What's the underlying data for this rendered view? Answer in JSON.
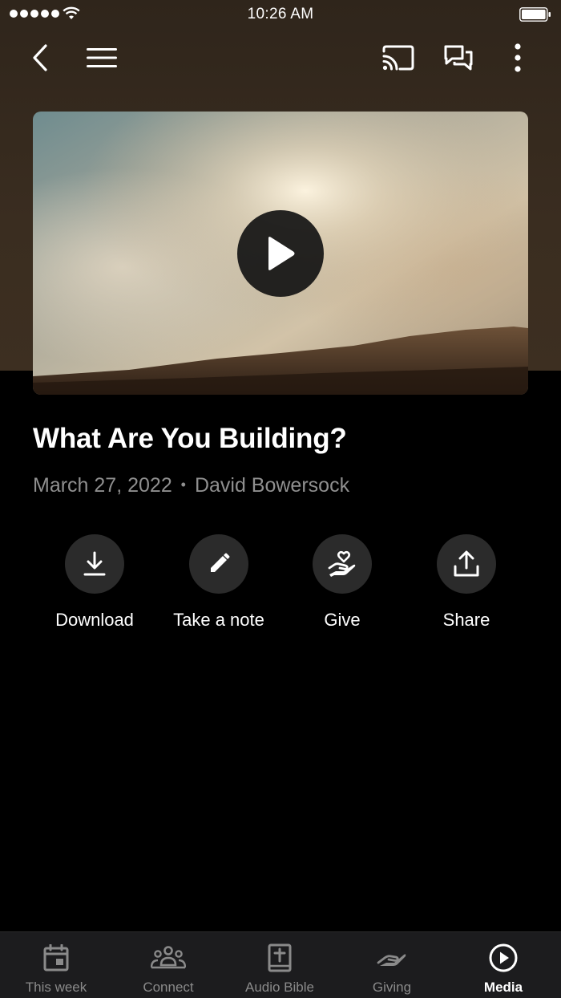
{
  "status_bar": {
    "time": "10:26 AM"
  },
  "toolbar": {
    "icons": [
      "back-icon",
      "menu-icon",
      "cast-icon",
      "chat-icon",
      "more-icon"
    ]
  },
  "video": {
    "play_icon": "play-icon"
  },
  "sermon": {
    "title": "What Are You Building?",
    "date": "March 27, 2022",
    "separator": "•",
    "speaker": "David Bowersock"
  },
  "actions": [
    {
      "label": "Download",
      "icon": "download-icon"
    },
    {
      "label": "Take a note",
      "icon": "pencil-icon"
    },
    {
      "label": "Give",
      "icon": "give-heart-hand-icon"
    },
    {
      "label": "Share",
      "icon": "share-upload-icon"
    }
  ],
  "tabs": [
    {
      "label": "This week",
      "icon": "calendar-icon",
      "active": false
    },
    {
      "label": "Connect",
      "icon": "people-icon",
      "active": false
    },
    {
      "label": "Audio Bible",
      "icon": "bible-icon",
      "active": false
    },
    {
      "label": "Giving",
      "icon": "giving-hand-icon",
      "active": false
    },
    {
      "label": "Media",
      "icon": "media-play-icon",
      "active": true
    }
  ],
  "colors": {
    "header_bg": "#3a2d20",
    "page_bg": "#000000",
    "action_circle": "#2b2b2b",
    "tabbar_bg": "#1c1c1e",
    "muted_text": "#8f8f8f"
  }
}
